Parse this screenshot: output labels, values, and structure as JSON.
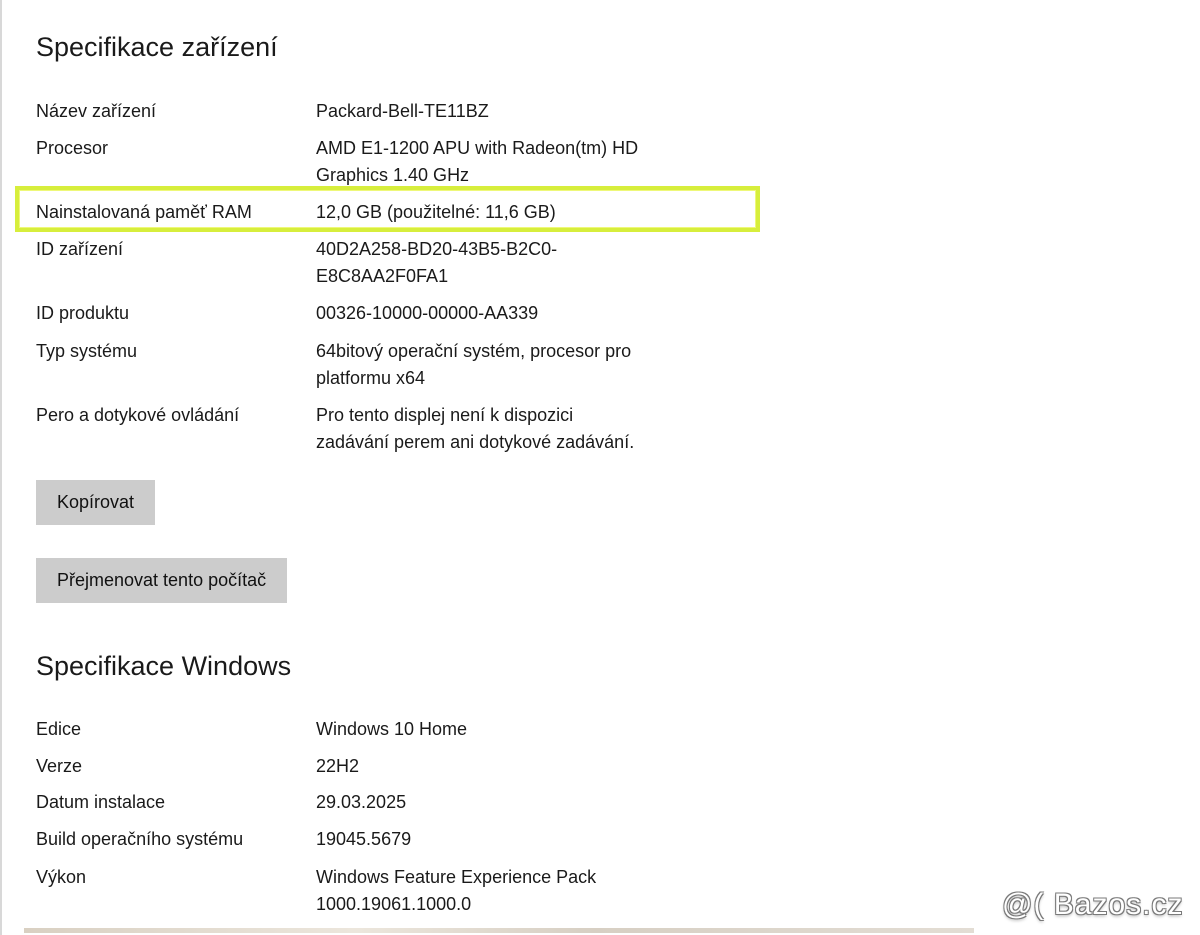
{
  "device_spec": {
    "title": "Specifikace zařízení",
    "rows": [
      {
        "label": "Název zařízení",
        "value": "Packard-Bell-TE11BZ"
      },
      {
        "label": "Procesor",
        "value": "AMD E1-1200 APU with Radeon(tm) HD\nGraphics   1.40 GHz"
      },
      {
        "label": "Nainstalovaná paměť RAM",
        "value": "12,0 GB (použitelné: 11,6 GB)"
      },
      {
        "label": "ID zařízení",
        "value": "40D2A258-BD20-43B5-B2C0-\nE8C8AA2F0FA1"
      },
      {
        "label": "ID produktu",
        "value": "00326-10000-00000-AA339"
      },
      {
        "label": "Typ systému",
        "value": "64bitový operační systém, procesor pro\nplatformu x64"
      },
      {
        "label": "Pero a dotykové ovládání",
        "value": "Pro tento displej není k dispozici\nzadávání perem ani dotykové zadávání."
      }
    ],
    "highlight_color": "#d7ee3c"
  },
  "buttons": {
    "copy_label": "Kopírovat",
    "rename_label": "Přejmenovat tento počítač"
  },
  "windows_spec": {
    "title": "Specifikace Windows",
    "rows": [
      {
        "label": "Edice",
        "value": "Windows 10 Home"
      },
      {
        "label": "Verze",
        "value": "22H2"
      },
      {
        "label": "Datum instalace",
        "value": "29.03.2025"
      },
      {
        "label": "Build operačního systému",
        "value": "19045.5679"
      },
      {
        "label": "Výkon",
        "value": "Windows Feature Experience Pack\n1000.19061.1000.0"
      }
    ]
  },
  "watermark": {
    "text": "@( Bazos.cz"
  }
}
